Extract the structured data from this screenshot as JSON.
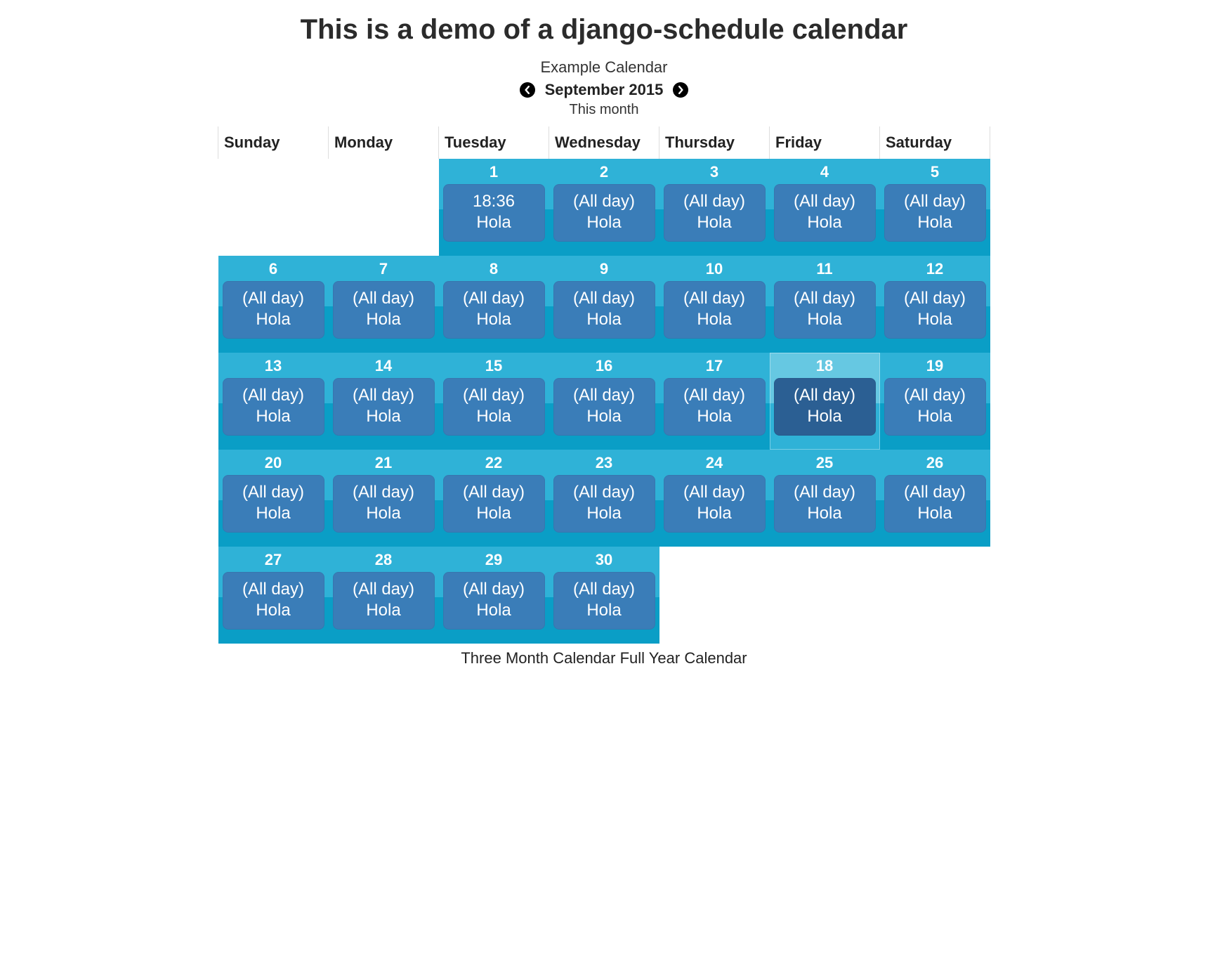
{
  "header": {
    "page_title": "This is a demo of a django-schedule calendar",
    "calendar_name": "Example Calendar",
    "month_label": "September 2015",
    "this_month_label": "This month"
  },
  "weekdays": [
    "Sunday",
    "Monday",
    "Tuesday",
    "Wednesday",
    "Thursday",
    "Friday",
    "Saturday"
  ],
  "weeks": [
    [
      {
        "day": null,
        "in_month": false,
        "today": false,
        "events": []
      },
      {
        "day": null,
        "in_month": false,
        "today": false,
        "events": []
      },
      {
        "day": "1",
        "in_month": true,
        "today": false,
        "events": [
          {
            "time": "18:36",
            "title": "Hola"
          }
        ]
      },
      {
        "day": "2",
        "in_month": true,
        "today": false,
        "events": [
          {
            "time": "(All day)",
            "title": "Hola"
          }
        ]
      },
      {
        "day": "3",
        "in_month": true,
        "today": false,
        "events": [
          {
            "time": "(All day)",
            "title": "Hola"
          }
        ]
      },
      {
        "day": "4",
        "in_month": true,
        "today": false,
        "events": [
          {
            "time": "(All day)",
            "title": "Hola"
          }
        ]
      },
      {
        "day": "5",
        "in_month": true,
        "today": false,
        "events": [
          {
            "time": "(All day)",
            "title": "Hola"
          }
        ]
      }
    ],
    [
      {
        "day": "6",
        "in_month": true,
        "today": false,
        "events": [
          {
            "time": "(All day)",
            "title": "Hola"
          }
        ]
      },
      {
        "day": "7",
        "in_month": true,
        "today": false,
        "events": [
          {
            "time": "(All day)",
            "title": "Hola"
          }
        ]
      },
      {
        "day": "8",
        "in_month": true,
        "today": false,
        "events": [
          {
            "time": "(All day)",
            "title": "Hola"
          }
        ]
      },
      {
        "day": "9",
        "in_month": true,
        "today": false,
        "events": [
          {
            "time": "(All day)",
            "title": "Hola"
          }
        ]
      },
      {
        "day": "10",
        "in_month": true,
        "today": false,
        "events": [
          {
            "time": "(All day)",
            "title": "Hola"
          }
        ]
      },
      {
        "day": "11",
        "in_month": true,
        "today": false,
        "events": [
          {
            "time": "(All day)",
            "title": "Hola"
          }
        ]
      },
      {
        "day": "12",
        "in_month": true,
        "today": false,
        "events": [
          {
            "time": "(All day)",
            "title": "Hola"
          }
        ]
      }
    ],
    [
      {
        "day": "13",
        "in_month": true,
        "today": false,
        "events": [
          {
            "time": "(All day)",
            "title": "Hola"
          }
        ]
      },
      {
        "day": "14",
        "in_month": true,
        "today": false,
        "events": [
          {
            "time": "(All day)",
            "title": "Hola"
          }
        ]
      },
      {
        "day": "15",
        "in_month": true,
        "today": false,
        "events": [
          {
            "time": "(All day)",
            "title": "Hola"
          }
        ]
      },
      {
        "day": "16",
        "in_month": true,
        "today": false,
        "events": [
          {
            "time": "(All day)",
            "title": "Hola"
          }
        ]
      },
      {
        "day": "17",
        "in_month": true,
        "today": false,
        "events": [
          {
            "time": "(All day)",
            "title": "Hola"
          }
        ]
      },
      {
        "day": "18",
        "in_month": true,
        "today": true,
        "events": [
          {
            "time": "(All day)",
            "title": "Hola"
          }
        ]
      },
      {
        "day": "19",
        "in_month": true,
        "today": false,
        "events": [
          {
            "time": "(All day)",
            "title": "Hola"
          }
        ]
      }
    ],
    [
      {
        "day": "20",
        "in_month": true,
        "today": false,
        "events": [
          {
            "time": "(All day)",
            "title": "Hola"
          }
        ]
      },
      {
        "day": "21",
        "in_month": true,
        "today": false,
        "events": [
          {
            "time": "(All day)",
            "title": "Hola"
          }
        ]
      },
      {
        "day": "22",
        "in_month": true,
        "today": false,
        "events": [
          {
            "time": "(All day)",
            "title": "Hola"
          }
        ]
      },
      {
        "day": "23",
        "in_month": true,
        "today": false,
        "events": [
          {
            "time": "(All day)",
            "title": "Hola"
          }
        ]
      },
      {
        "day": "24",
        "in_month": true,
        "today": false,
        "events": [
          {
            "time": "(All day)",
            "title": "Hola"
          }
        ]
      },
      {
        "day": "25",
        "in_month": true,
        "today": false,
        "events": [
          {
            "time": "(All day)",
            "title": "Hola"
          }
        ]
      },
      {
        "day": "26",
        "in_month": true,
        "today": false,
        "events": [
          {
            "time": "(All day)",
            "title": "Hola"
          }
        ]
      }
    ],
    [
      {
        "day": "27",
        "in_month": true,
        "today": false,
        "events": [
          {
            "time": "(All day)",
            "title": "Hola"
          }
        ]
      },
      {
        "day": "28",
        "in_month": true,
        "today": false,
        "events": [
          {
            "time": "(All day)",
            "title": "Hola"
          }
        ]
      },
      {
        "day": "29",
        "in_month": true,
        "today": false,
        "events": [
          {
            "time": "(All day)",
            "title": "Hola"
          }
        ]
      },
      {
        "day": "30",
        "in_month": true,
        "today": false,
        "events": [
          {
            "time": "(All day)",
            "title": "Hola"
          }
        ]
      },
      {
        "day": null,
        "in_month": false,
        "today": false,
        "events": []
      },
      {
        "day": null,
        "in_month": false,
        "today": false,
        "events": []
      },
      {
        "day": null,
        "in_month": false,
        "today": false,
        "events": []
      }
    ]
  ],
  "footer": {
    "three_month_label": "Three Month Calendar",
    "full_year_label": "Full Year Calendar"
  }
}
